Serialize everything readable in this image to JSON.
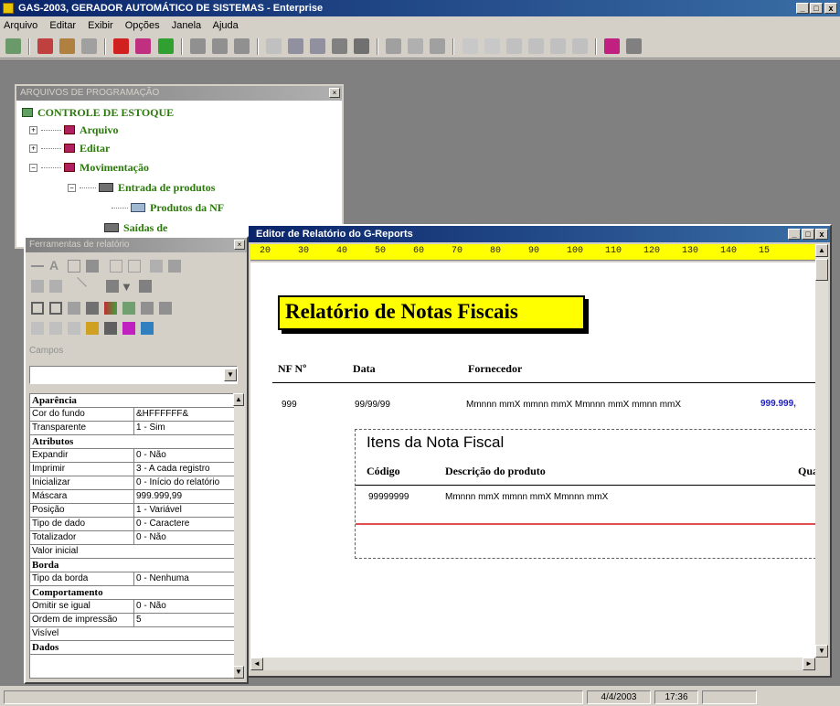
{
  "window": {
    "title": "GAS-2003, GERADOR AUTOMÁTICO DE SISTEMAS - Enterprise",
    "min": "_",
    "max": "□",
    "close": "x"
  },
  "menu": [
    "Arquivo",
    "Editar",
    "Exibir",
    "Opções",
    "Janela",
    "Ajuda"
  ],
  "tree": {
    "title": "ARQUIVOS DE PROGRAMAÇÃO",
    "root": "CONTROLE DE ESTOQUE",
    "items": [
      {
        "label": "Arquivo",
        "sign": "+"
      },
      {
        "label": "Editar",
        "sign": "+"
      },
      {
        "label": "Movimentação",
        "sign": "−"
      },
      {
        "label": "Entrada de produtos",
        "sign": "−"
      },
      {
        "label": "Produtos da NF",
        "sign": ""
      },
      {
        "label": "Saídas de",
        "sign": ""
      }
    ]
  },
  "tools": {
    "title": "Ferramentas de relatório",
    "category_label": "Campos",
    "props": [
      {
        "k": "Aparência",
        "v": "",
        "head": true
      },
      {
        "k": "Cor do fundo",
        "v": "&HFFFFFF&"
      },
      {
        "k": "Transparente",
        "v": "1 - Sim"
      },
      {
        "k": "Atributos",
        "v": "",
        "head": true
      },
      {
        "k": "Expandir",
        "v": "0 - Não"
      },
      {
        "k": "Imprimir",
        "v": "3 - A cada registro"
      },
      {
        "k": "Inicializar",
        "v": "0 - Início do relatório"
      },
      {
        "k": "Máscara",
        "v": "999.999,99"
      },
      {
        "k": "Posição",
        "v": "1 - Variável"
      },
      {
        "k": "Tipo de dado",
        "v": "0 - Caractere"
      },
      {
        "k": "Totalizador",
        "v": "0 - Não"
      },
      {
        "k": "Valor inicial",
        "v": ""
      },
      {
        "k": "Borda",
        "v": "",
        "head": true
      },
      {
        "k": "Tipo da borda",
        "v": "0 - Nenhuma"
      },
      {
        "k": "Comportamento",
        "v": "",
        "head": true
      },
      {
        "k": "Omitir se igual",
        "v": "0 - Não"
      },
      {
        "k": "Ordem de impressão",
        "v": "5"
      },
      {
        "k": "Visível",
        "v": ""
      },
      {
        "k": "Dados",
        "v": "",
        "head": true
      }
    ]
  },
  "report": {
    "title": "Editor de Relatório do G-Reports",
    "ruler": [
      "20",
      "30",
      "40",
      "50",
      "60",
      "70",
      "80",
      "90",
      "100",
      "110",
      "120",
      "130",
      "140",
      "15"
    ],
    "heading": "Relatório de Notas Fiscais",
    "cols": {
      "nf": "NF Nº",
      "data": "Data",
      "fornecedor": "Fornecedor"
    },
    "row": {
      "nf": "999",
      "data": "99/99/99",
      "fornecedor": "Mmnnn mmX mmnn mmX Mmnnn mmX mmnn mmX",
      "valor": "999.999,"
    },
    "sub": {
      "title": "Itens da Nota Fiscal",
      "cols": {
        "codigo": "Código",
        "descricao": "Descrição do produto",
        "quant": "Quant"
      },
      "row": {
        "codigo": "99999999",
        "descricao": "Mmnnn mmX mmnn mmX Mmnnn mmX"
      }
    }
  },
  "status": {
    "date": "4/4/2003",
    "time": "17:36"
  }
}
